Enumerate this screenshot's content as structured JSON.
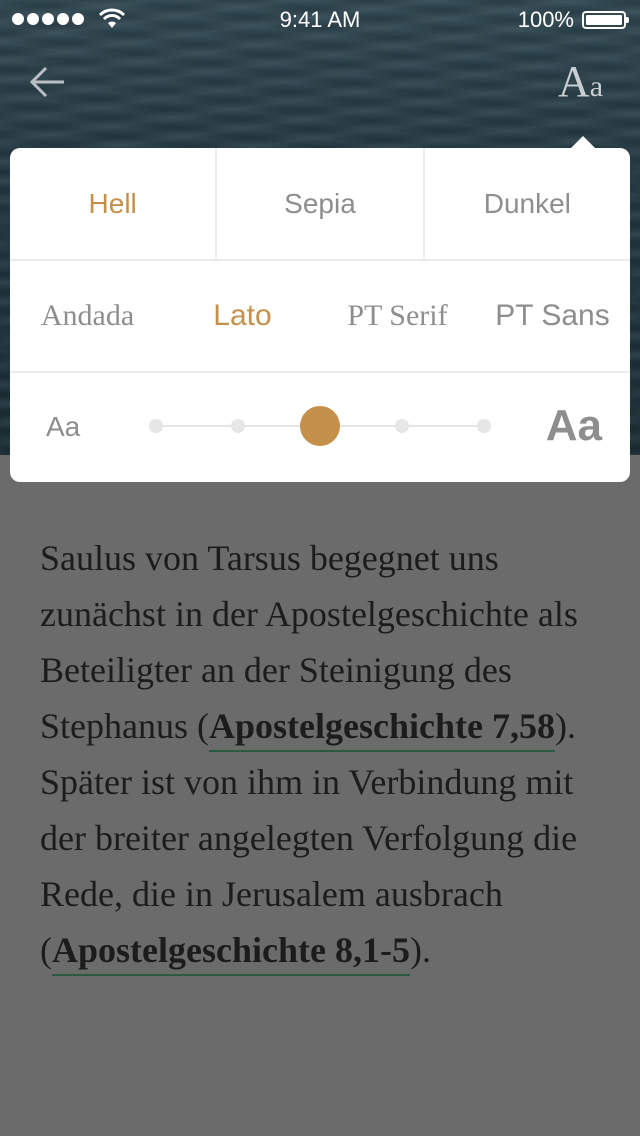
{
  "status_bar": {
    "time": "9:41 AM",
    "battery": "100%",
    "signal_icon": "signal-dots-icon",
    "wifi_icon": "wifi-icon",
    "battery_icon": "battery-icon"
  },
  "nav": {
    "back_icon": "arrow-left-icon",
    "typography_big": "A",
    "typography_small": "a"
  },
  "settings": {
    "themes": [
      "Hell",
      "Sepia",
      "Dunkel"
    ],
    "active_theme": "Hell",
    "fonts": [
      "Andada",
      "Lato",
      "PT Serif",
      "PT Sans"
    ],
    "active_font": "Lato",
    "size_small_label": "Aa",
    "size_large_label": "Aa",
    "size_steps": 5,
    "size_level": 3,
    "accent_color": "#c4904a"
  },
  "article": {
    "p1_text1": "Saulus von Tarsus begegnet uns zunächst in der Apostelgeschichte als Beteiligter an der Steinigung des Stephanus (",
    "ref1": "Apostelgeschichte 7,58",
    "p1_text2": "). Später ist von ihm in Verbindung mit der breiter angelegten Verfolgung die Rede, die in Jerusalem ausbrach (",
    "ref2": "Apostelgeschichte 8,1-5",
    "p1_text3": ")."
  }
}
